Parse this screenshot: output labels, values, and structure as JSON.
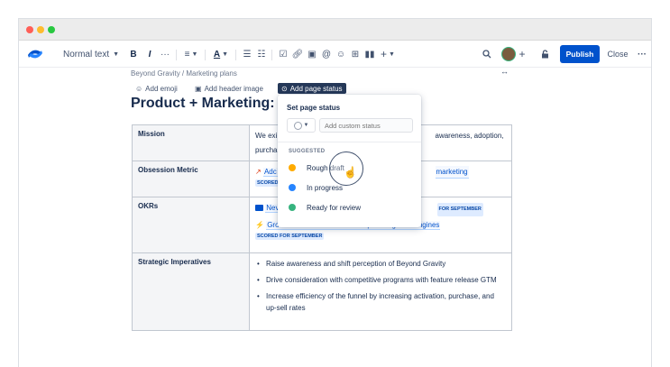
{
  "toolbar": {
    "text_style": "Normal text",
    "bold": "B",
    "italic": "I",
    "more": "···",
    "align": "≡",
    "color": "A",
    "insert": "+",
    "publish": "Publish",
    "close": "Close",
    "overflow": "···"
  },
  "breadcrumb": "Beyond Gravity / Marketing plans",
  "actions": {
    "emoji": "Add emoji",
    "header_image": "Add header image",
    "page_status": "Add page status"
  },
  "page_title": "Product + Marketing: St",
  "status_popup": {
    "title": "Set page status",
    "placeholder": "Add custom status",
    "section": "SUGGESTED",
    "options": [
      {
        "label": "Rough draft",
        "color": "#FFAB00"
      },
      {
        "label": "In progress",
        "color": "#2684FF"
      },
      {
        "label": "Ready for review",
        "color": "#36B37E"
      }
    ]
  },
  "table": {
    "mission": {
      "label": "Mission",
      "text_a": "We exi",
      "text_b": "awareness, adoption,",
      "text_c": "purcha"
    },
    "obsession": {
      "label": "Obsession Metric",
      "link_a": "Adc",
      "link_b": "marketing",
      "badge": "SCORED"
    },
    "okrs": {
      "label": "OKRs",
      "link_a": "Nev",
      "badge_a": "FOR SEPTEMBER",
      "link_b": "Gross new customers as we supercharge our engines",
      "badge_b": "SCORED FOR SEPTEMBER"
    },
    "imperatives": {
      "label": "Strategic Imperatives",
      "bullets": [
        "Raise awareness and shift perception of Beyond Gravity",
        "Drive consideration with competitive programs with feature release GTM",
        "Increase efficiency of the funnel by increasing activation, purchase, and up-sell rates"
      ]
    }
  },
  "colors": {
    "accent": "#0052CC",
    "brand": "#0052CC"
  }
}
